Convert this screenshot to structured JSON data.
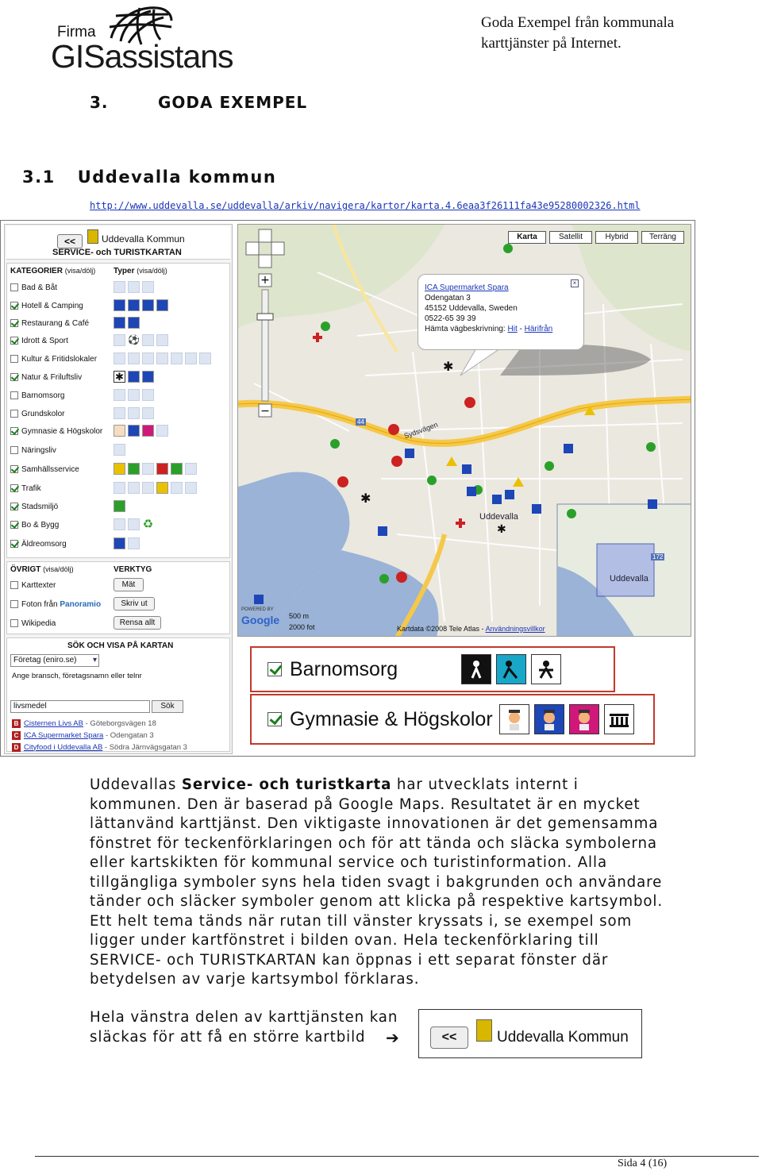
{
  "header": {
    "logo_prefix": "Firma",
    "logo_name": "GISassistans",
    "doc_title_line1": "Goda Exempel från kommunala",
    "doc_title_line2": "karttjänster på Internet."
  },
  "section": {
    "number": "3.",
    "title": "GODA EXEMPEL"
  },
  "subsection": {
    "number": "3.1",
    "title": "Uddevalla kommun",
    "url": "http://www.uddevalla.se/uddevalla/arkiv/navigera/kartor/karta.4.6eaa3f26111fa43e95280002326.html"
  },
  "screenshot": {
    "panel": {
      "back_label": "<<",
      "title": "Uddevalla Kommun",
      "subtitle": "SERVICE- och TURISTKARTAN",
      "kategorier_label": "KATEGORIER",
      "kategorier_toggle": "(visa/dölj)",
      "typer_label": "Typer",
      "typer_toggle": "(visa/dölj)",
      "categories": [
        {
          "label": "Bad & Båt",
          "checked": false
        },
        {
          "label": "Hotell & Camping",
          "checked": true
        },
        {
          "label": "Restaurang & Café",
          "checked": true
        },
        {
          "label": "Idrott & Sport",
          "checked": true
        },
        {
          "label": "Kultur & Fritidslokaler",
          "checked": false
        },
        {
          "label": "Natur & Friluftsliv",
          "checked": true
        },
        {
          "label": "Barnomsorg",
          "checked": false
        },
        {
          "label": "Grundskolor",
          "checked": false
        },
        {
          "label": "Gymnasie & Högskolor",
          "checked": true
        },
        {
          "label": "Näringsliv",
          "checked": false
        },
        {
          "label": "Samhällsservice",
          "checked": true
        },
        {
          "label": "Trafik",
          "checked": true
        },
        {
          "label": "Stadsmiljö",
          "checked": true
        },
        {
          "label": "Bo & Bygg",
          "checked": true
        },
        {
          "label": "Äldreomsorg",
          "checked": true
        }
      ],
      "ovrigt_label": "ÖVRIGT",
      "ovrigt_toggle": "(visa/dölj)",
      "verktyg_label": "VERKTYG",
      "ovrigt_items": [
        {
          "label": "Karttexter",
          "checked": false
        },
        {
          "label": "Foton från",
          "suffix": "Panoramio",
          "checked": false
        },
        {
          "label": "Wikipedia",
          "checked": false
        }
      ],
      "tools": [
        "Mät",
        "Skriv ut",
        "Rensa allt"
      ],
      "search": {
        "heading": "SÖK OCH VISA PÅ KARTAN",
        "select_value": "Företag (eniro.se)",
        "hint": "Ange bransch, företagsnamn eller telnr",
        "input_value": "livsmedel",
        "button": "Sök",
        "results": [
          {
            "letter": "B",
            "name": "Cisternen Livs AB",
            "address": "- Göteborgsvägen 18"
          },
          {
            "letter": "C",
            "name": "ICA Supermarket Spara",
            "address": "- Odengatan 3"
          },
          {
            "letter": "D",
            "name": "Cityfood i Uddevalla AB",
            "address": "- Södra Järnvägsgatan 3"
          }
        ]
      }
    },
    "map": {
      "types": [
        "Karta",
        "Satellit",
        "Hybrid",
        "Terräng"
      ],
      "active_type": "Karta",
      "info": {
        "name": "ICA Supermarket Spara",
        "street": "Odengatan 3",
        "city": "45152 Uddevalla, Sweden",
        "phone": "0522-65 39 39",
        "directions_label": "Hämta vägbeskrivning:",
        "dir_to": "Hit",
        "dir_sep": "-",
        "dir_from": "Härifrån"
      },
      "places": {
        "city": "Uddevalla",
        "overview": "Uddevalla",
        "road": "Sydsvägen",
        "r44": "44",
        "r172": "172"
      },
      "scale_m": "500 m",
      "scale_ft": "2000 fot",
      "powered_by": "POWERED BY",
      "google": "Google",
      "copyright": "Kartdata ©2008 Tele Atlas -",
      "terms": "Användningsvillkor"
    },
    "callouts": [
      {
        "label": "Barnomsorg",
        "icon_colors": [
          "#111111",
          "#18a6c9",
          "#ffffff"
        ]
      },
      {
        "label": "Gymnasie & Högskolor",
        "icon_colors": [
          "#ffffff",
          "#1d46b7",
          "#d0187a",
          "#ffffff"
        ]
      }
    ]
  },
  "body": {
    "para_start": "Uddevallas ",
    "para_bold": "Service- och turistkarta",
    "para_rest": " har utvecklats internt i kommunen. Den är baserad på Google Maps. Resultatet är en mycket lättanvänd karttjänst. Den viktigaste innovationen är det gemensamma fönstret för teckenförklaringen och för att tända och släcka symbolerna eller kartskikten för kommunal service och turistinformation. Alla tillgängliga symboler syns hela tiden svagt i bakgrunden och användare tänder och släcker symboler genom att klicka på respektive kartsymbol. Ett helt tema tänds när rutan till vänster kryssats i, se exempel som ligger under kartfönstret i bilden ovan. Hela teckenförklaring till SERVICE- och TURISTKARTAN kan öppnas i ett separat fönster där betydelsen av varje kartsymbol förklaras.",
    "para2": "Hela vänstra delen av karttjänsten kan släckas för att få en större kartbild",
    "arrow": "➔",
    "strip_back": "<<",
    "strip_title": "Uddevalla Kommun"
  },
  "footer": {
    "page_label": "Sida 4 (16)"
  }
}
